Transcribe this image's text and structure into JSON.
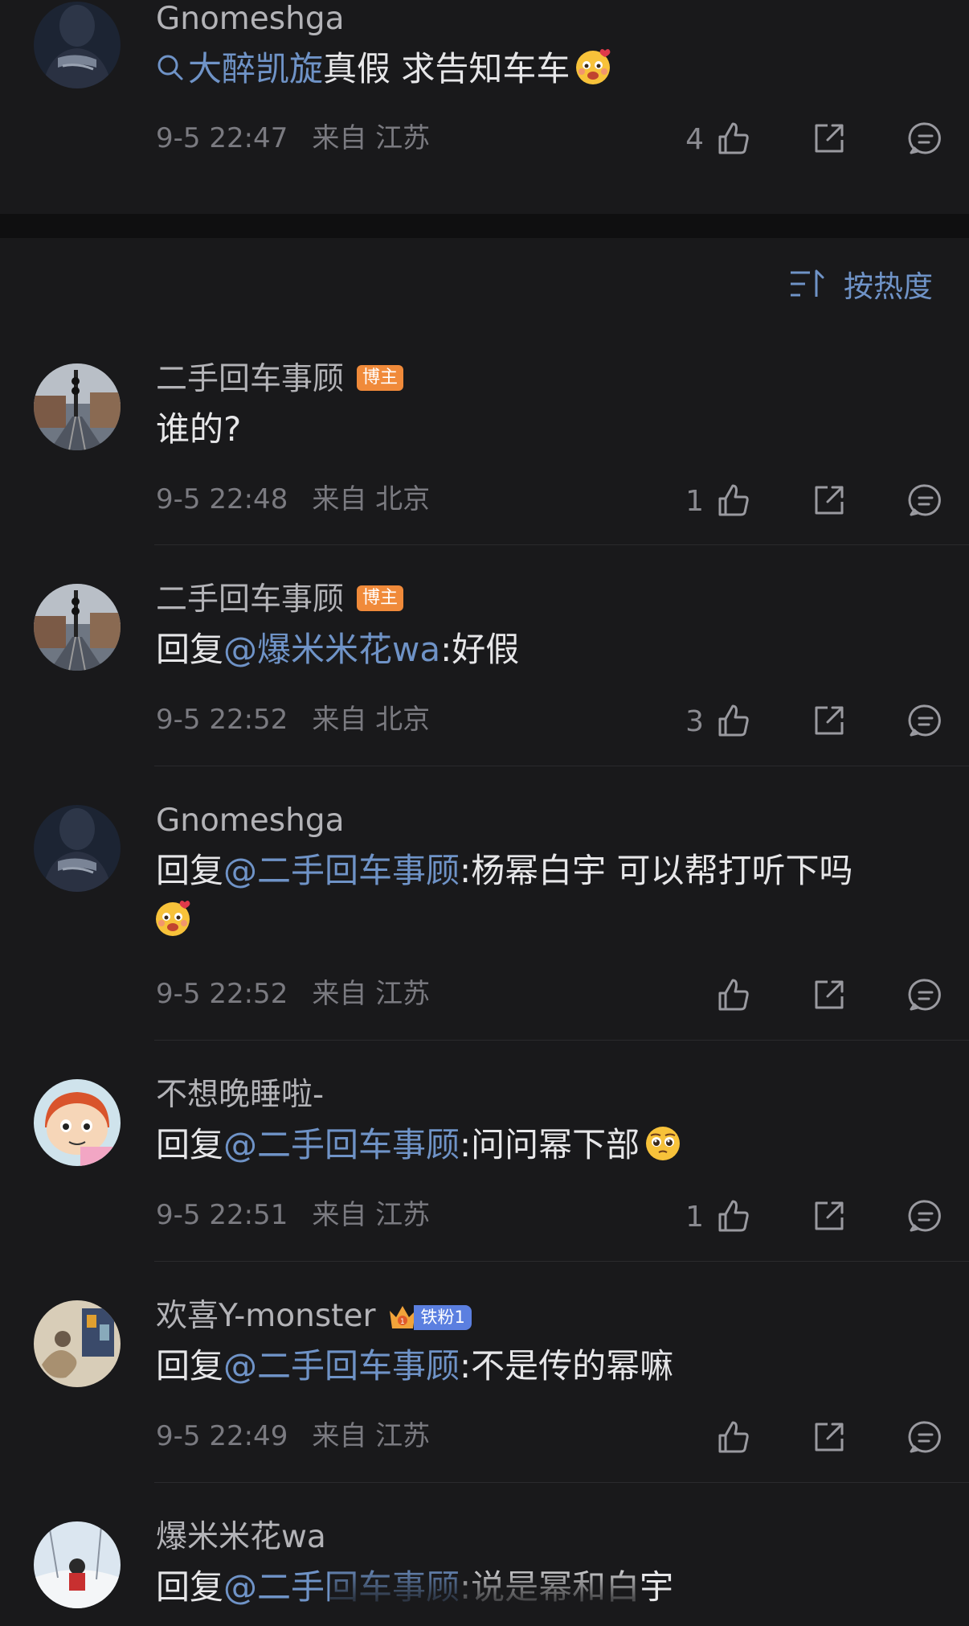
{
  "top_comment": {
    "author": "Gnomeshga",
    "search_term": "大醉凯旋",
    "text_after": "真假 求告知车车",
    "time": "9-5 22:47",
    "location": "来自 江苏",
    "likes": "4",
    "icons": {
      "search": "search-icon",
      "emoji": "blush-heart-emoji"
    }
  },
  "sort": {
    "label": "按热度",
    "icon": "sort-icon"
  },
  "comments": [
    {
      "author": "二手回车事顾",
      "badge": "博主",
      "text": "谁的?",
      "time": "9-5 22:48",
      "location": "来自 北京",
      "likes": "1"
    },
    {
      "author": "二手回车事顾",
      "badge": "博主",
      "reply_prefix": "回复",
      "mention": "@爆米米花wa",
      "text": ":好假",
      "time": "9-5 22:52",
      "location": "来自 北京",
      "likes": "3"
    },
    {
      "author": "Gnomeshga",
      "reply_prefix": "回复",
      "mention": "@二手回车事顾",
      "text": ":杨幂白宇 可以帮打听下吗",
      "time": "9-5 22:52",
      "location": "来自 江苏",
      "likes": ""
    },
    {
      "author": "不想晚睡啦-",
      "reply_prefix": "回复",
      "mention": "@二手回车事顾",
      "text": ":问问幂下部",
      "time": "9-5 22:51",
      "location": "来自 江苏",
      "likes": "1"
    },
    {
      "author": "欢喜Y-monster",
      "fan_badge": "铁粉1",
      "reply_prefix": "回复",
      "mention": "@二手回车事顾",
      "text": ":不是传的幂嘛",
      "time": "9-5 22:49",
      "location": "来自 江苏",
      "likes": ""
    },
    {
      "author": "爆米米花wa",
      "reply_prefix": "回复",
      "mention": "@二手回车事顾",
      "text": ":说是幂和白宇"
    }
  ],
  "colors": {
    "background": "#19191b",
    "mention": "#6f93c7",
    "badge_blogger": "#f08a3a",
    "badge_fan": "#5b7fe0"
  }
}
